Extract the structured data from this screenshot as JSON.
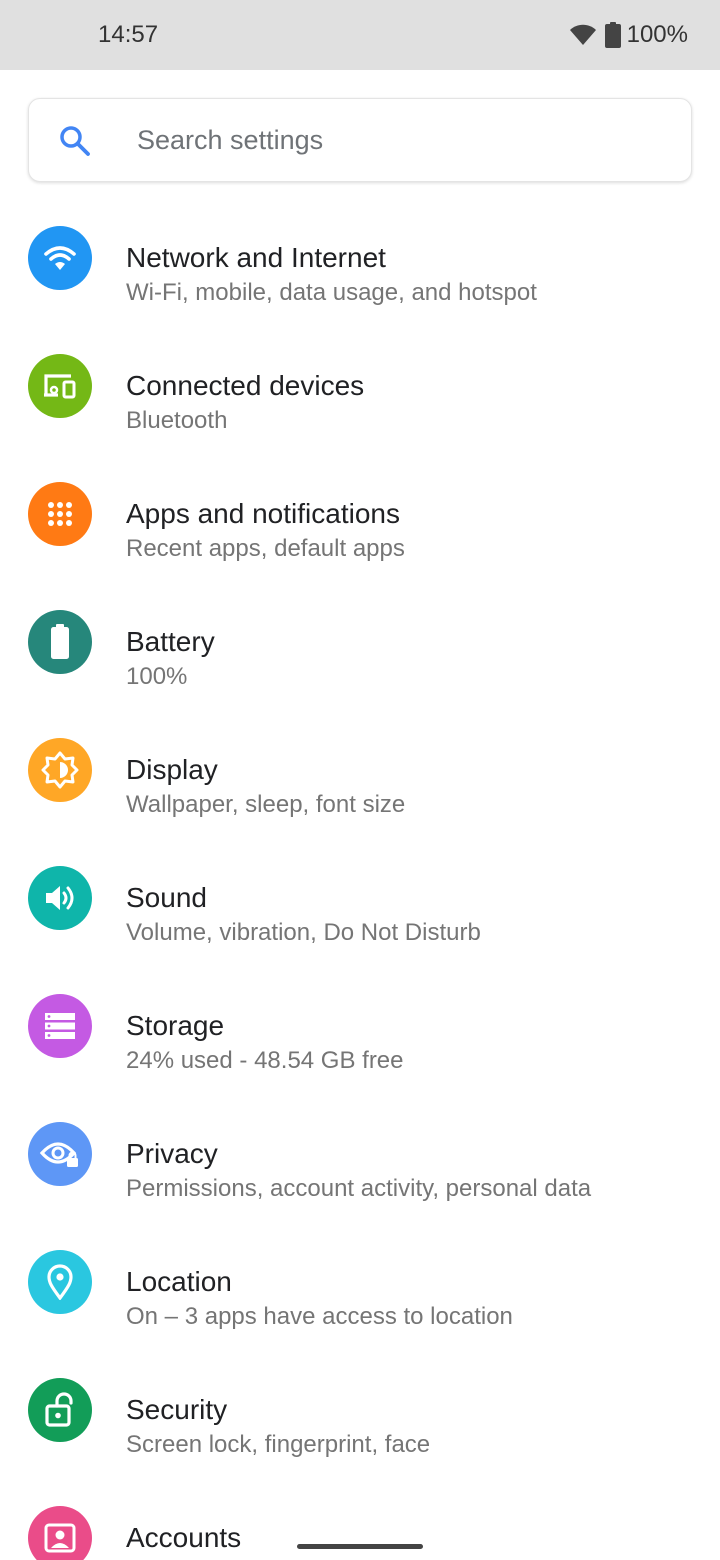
{
  "status_bar": {
    "time": "14:57",
    "battery_percent": "100%",
    "icons": [
      "wifi-icon",
      "battery-icon"
    ]
  },
  "search": {
    "placeholder": "Search settings",
    "icon": "search-icon",
    "accent_color": "#4285f4"
  },
  "settings": [
    {
      "title": "Network and Internet",
      "summary": "Wi-Fi, mobile, data usage, and hotspot",
      "icon": "wifi-icon",
      "color": "#2196f3"
    },
    {
      "title": "Connected devices",
      "summary": "Bluetooth",
      "icon": "connected-devices-icon",
      "color": "#74b816"
    },
    {
      "title": "Apps and notifications",
      "summary": "Recent apps, default apps",
      "icon": "apps-grid-icon",
      "color": "#ff7a14"
    },
    {
      "title": "Battery",
      "summary": "100%",
      "icon": "battery-icon",
      "color": "#26877b"
    },
    {
      "title": "Display",
      "summary": "Wallpaper, sleep, font size",
      "icon": "brightness-icon",
      "color": "#ffa726"
    },
    {
      "title": "Sound",
      "summary": "Volume, vibration, Do Not Disturb",
      "icon": "volume-icon",
      "color": "#0fb5aa"
    },
    {
      "title": "Storage",
      "summary": "24% used - 48.54 GB free",
      "icon": "storage-icon",
      "color": "#c45ae3"
    },
    {
      "title": "Privacy",
      "summary": "Permissions, account activity, personal data",
      "icon": "privacy-eye-icon",
      "color": "#5e97f6"
    },
    {
      "title": "Location",
      "summary": "On – 3 apps have access to location",
      "icon": "location-pin-icon",
      "color": "#2ac7e0"
    },
    {
      "title": "Security",
      "summary": "Screen lock, fingerprint, face",
      "icon": "unlocked-padlock-icon",
      "color": "#129d58"
    },
    {
      "title": "Accounts",
      "summary": "",
      "icon": "account-icon",
      "color": "#ea4c89"
    }
  ]
}
